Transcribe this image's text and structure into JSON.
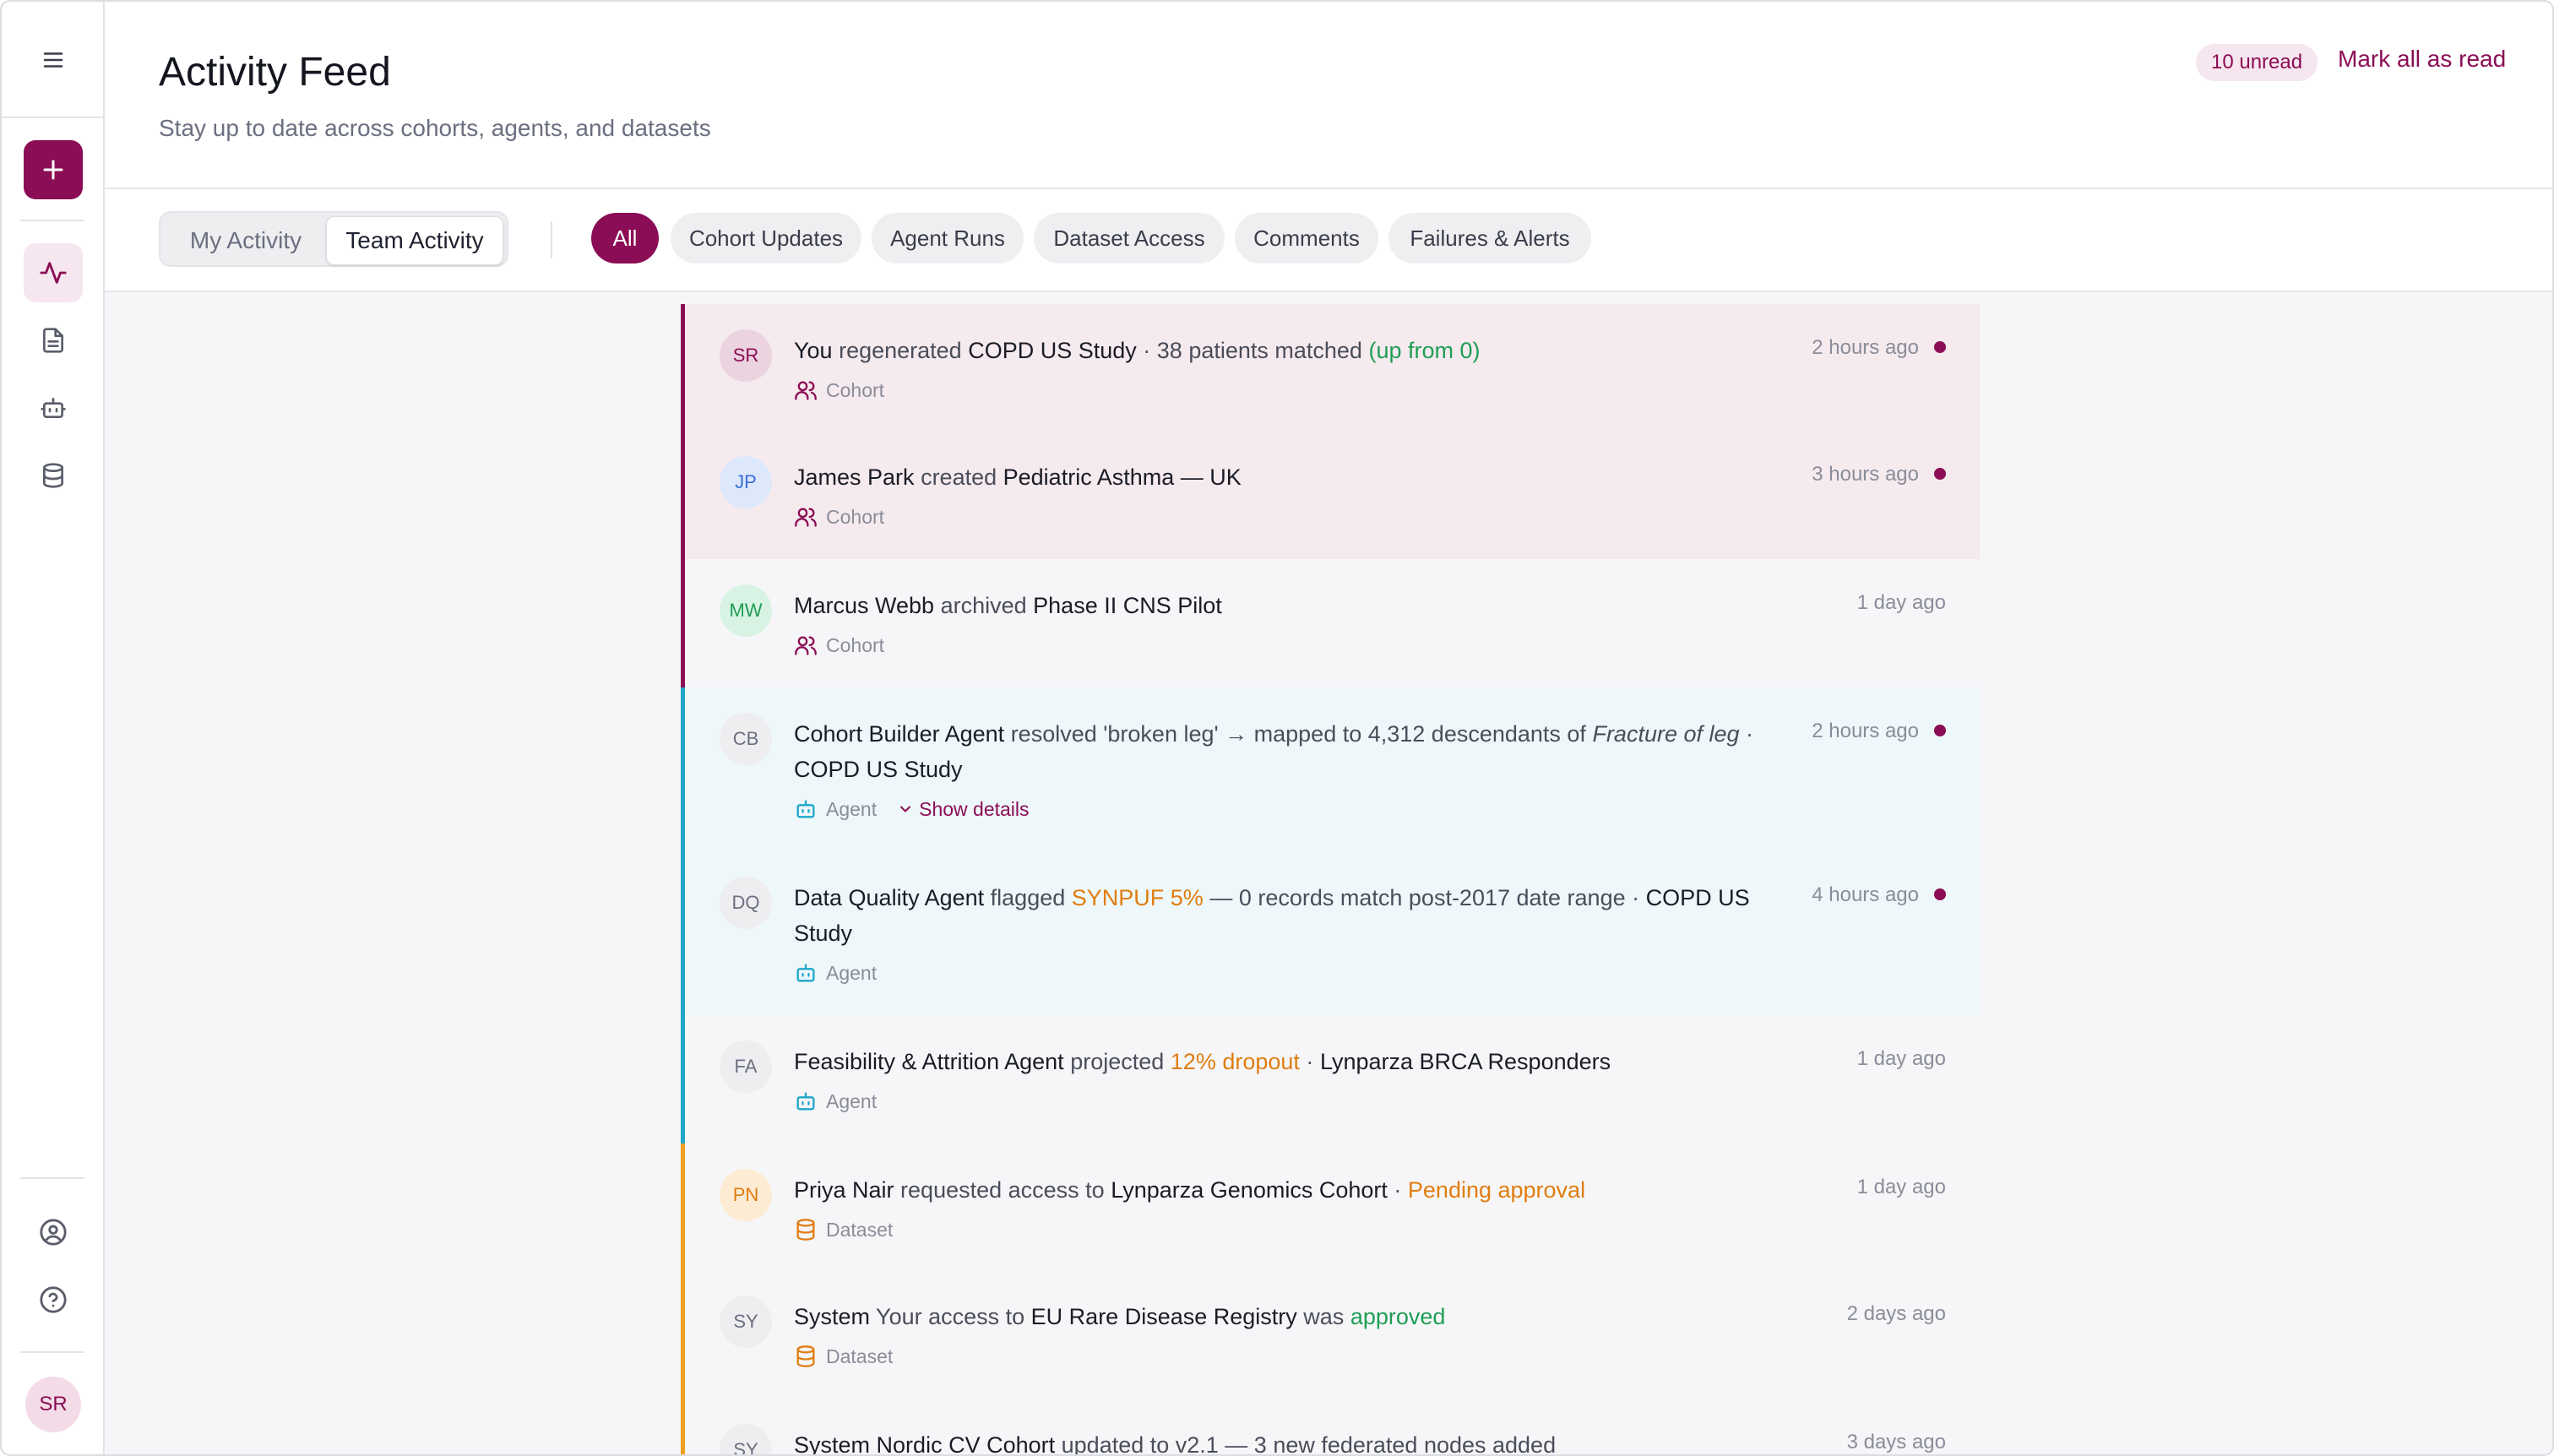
{
  "header": {
    "title": "Activity Feed",
    "subtitle": "Stay up to date across cohorts, agents, and datasets",
    "unread_badge": "10 unread",
    "mark_all_read": "Mark all as read"
  },
  "sidebar": {
    "avatar_initials": "SR",
    "icons": [
      "menu-icon",
      "plus-icon",
      "activity-icon",
      "document-icon",
      "bot-icon",
      "database-icon",
      "user-circle-icon",
      "help-icon"
    ]
  },
  "segments": [
    "My Activity",
    "Team Activity"
  ],
  "filters": [
    "All",
    "Cohort Updates",
    "Agent Runs",
    "Dataset Access",
    "Comments",
    "Failures & Alerts"
  ],
  "colors": {
    "brand": "#8b0d55",
    "cohort_bar": "#8b0d55",
    "agent_bar": "#1fa7c9",
    "dataset_bar": "#f0a020",
    "green": "#1f9d55",
    "orange": "#e07d10"
  },
  "feed": [
    {
      "initials": "SR",
      "actor": "You",
      "verb": "regenerated",
      "object": "COPD US Study",
      "detail": "· 38 patients matched",
      "highlight": "(up from 0)",
      "time": "2 hours ago",
      "tag": "Cohort"
    },
    {
      "initials": "JP",
      "actor": "James Park",
      "verb": "created",
      "object": "Pediatric Asthma — UK",
      "time": "3 hours ago",
      "tag": "Cohort"
    },
    {
      "initials": "MW",
      "actor": "Marcus Webb",
      "verb": "archived",
      "object": "Phase II CNS Pilot",
      "time": "1 day ago",
      "tag": "Cohort"
    },
    {
      "initials": "CB",
      "actor": "Cohort Builder Agent",
      "verb": "resolved 'broken leg' → mapped to 4,312 descendants of",
      "italic": "Fracture of leg",
      "sep": "·",
      "object": "COPD US Study",
      "time": "2 hours ago",
      "tag": "Agent",
      "show_details": "Show details"
    },
    {
      "initials": "DQ",
      "actor": "Data Quality Agent",
      "verb": "flagged",
      "highlight": "SYNPUF 5%",
      "detail": "— 0 records match post-2017 date range ·",
      "object": "COPD US Study",
      "time": "4 hours ago",
      "tag": "Agent"
    },
    {
      "initials": "FA",
      "actor": "Feasibility & Attrition Agent",
      "verb": "projected",
      "highlight": "12% dropout",
      "detail": "·",
      "object": "Lynparza BRCA Responders",
      "time": "1 day ago",
      "tag": "Agent"
    },
    {
      "initials": "PN",
      "actor": "Priya Nair",
      "verb": "requested access to",
      "object": "Lynparza Genomics Cohort",
      "detail": "·",
      "highlight": "Pending approval",
      "time": "1 day ago",
      "tag": "Dataset"
    },
    {
      "initials": "SY",
      "actor": "System",
      "verb": "Your access to",
      "object": "EU Rare Disease Registry",
      "detail": "was",
      "highlight": "approved",
      "time": "2 days ago",
      "tag": "Dataset"
    },
    {
      "initials": "SY",
      "actor": "System",
      "object": "Nordic CV Cohort",
      "verb": "updated to v2.1 — 3 new federated nodes added",
      "time": "3 days ago"
    }
  ]
}
